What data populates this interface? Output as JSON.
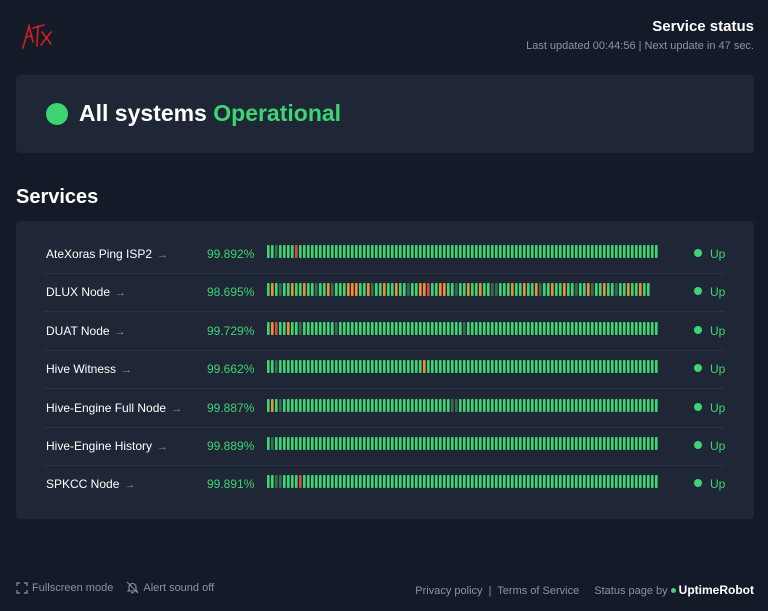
{
  "header": {
    "title": "Service status",
    "subtitle": "Last updated 00:44:56 | Next update in 47 sec."
  },
  "overall": {
    "prefix": "All systems",
    "status": "Operational"
  },
  "services_title": "Services",
  "services": [
    {
      "name": "AteXoras Ping ISP2",
      "uptime": "99.892%",
      "status": "Up",
      "bars": "ggdggggrgggggggggggggggggggggggggggggggggggggggggggggggggggggggggggggggggggggggggggggggggggggggggg"
    },
    {
      "name": "DLUX Node",
      "uptime": "98.695%",
      "status": "Up",
      "bars": "gogdggoggoggdggodgggoooggodggoggoggdggoorggooggdggoggoggddgggoggoggodggoggoggdggodggoggdggoggogg"
    },
    {
      "name": "DUAT Node",
      "uptime": "99.729%",
      "status": "Up",
      "bars": "gorggoggdggggggggdgggggggggggggggggggggggggggggggdgggggggggggggggggggggggggggggggggggggggggggggggg"
    },
    {
      "name": "Hive Witness",
      "uptime": "99.662%",
      "status": "Up",
      "bars": "ggdggggggggggggggggggggggggggggggggggggoggggggggggggggggggggggggggggggggggggggggggggggggggggggggggr"
    },
    {
      "name": "Hive-Engine Full Node",
      "uptime": "99.887%",
      "status": "Up",
      "bars": "gogdggggggggggggggggggggggggggggggggggggggggggddgggggggggggggggggggggggggggggggggggggggggggggggggg"
    },
    {
      "name": "Hive-Engine History",
      "uptime": "99.889%",
      "status": "Up",
      "bars": "gdggggggggggggggggggggggggggggggggggggggggggggggggggggggggggggggggggggggggggggggggggggggggggggggggg"
    },
    {
      "name": "SPKCC Node",
      "uptime": "99.891%",
      "status": "Up",
      "bars": "ggddggggrgggggggggggggggggggggggggggggggggggggggggggggggggggggggggggggggggggggggggggggggggggggggggg"
    }
  ],
  "bar_colors": {
    "g": "#3bd671",
    "d": "#3d6b4f",
    "o": "#f29030",
    "r": "#df484a"
  },
  "footer": {
    "fullscreen": "Fullscreen mode",
    "alert": "Alert sound off",
    "privacy": "Privacy policy",
    "terms": "Terms of Service",
    "status_page_by": "Status page by",
    "brand": "UptimeRobot",
    "separator": "|"
  }
}
